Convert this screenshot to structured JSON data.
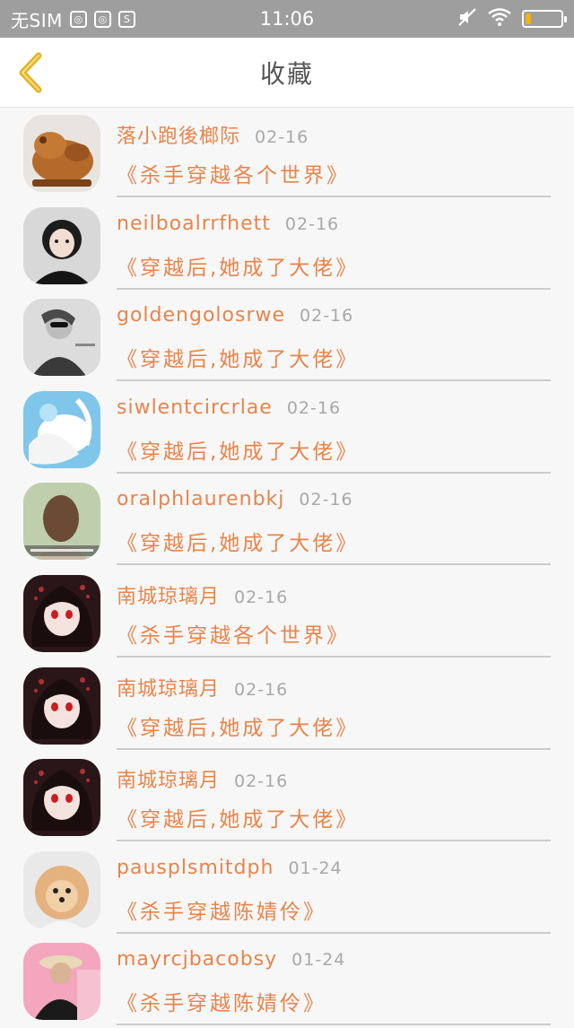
{
  "status_bar": {
    "carrier": "无SIM",
    "time": "11:06",
    "battery_level": 0.15,
    "notification_icons": [
      "qq-icon",
      "qq-icon",
      "s-app-icon"
    ],
    "notification_glyphs": [
      "◎",
      "◎",
      "S"
    ]
  },
  "header": {
    "title": "收藏"
  },
  "favorites": [
    {
      "user": "落小跑後榔际",
      "date": "02-16",
      "book": "《杀手穿越各个世界》",
      "avatar": "avatar-wood-carving"
    },
    {
      "user": "neilboalrrfhett",
      "date": "02-16",
      "book": "《穿越后,她成了大佬》",
      "avatar": "avatar-girl-dark"
    },
    {
      "user": "goldengolosrwe",
      "date": "02-16",
      "book": "《穿越后,她成了大佬》",
      "avatar": "avatar-girl-sunglasses"
    },
    {
      "user": "siwlentcircrlae",
      "date": "02-16",
      "book": "《穿越后,她成了大佬》",
      "avatar": "avatar-anime-white"
    },
    {
      "user": "oralphlaurenbkj",
      "date": "02-16",
      "book": "《穿越后,她成了大佬》",
      "avatar": "avatar-girl-back"
    },
    {
      "user": "南城琼璃月",
      "date": "02-16",
      "book": "《杀手穿越各个世界》",
      "avatar": "avatar-anime-red-eyes"
    },
    {
      "user": "南城琼璃月",
      "date": "02-16",
      "book": "《穿越后,她成了大佬》",
      "avatar": "avatar-anime-red-eyes"
    },
    {
      "user": "南城琼璃月",
      "date": "02-16",
      "book": "《穿越后,她成了大佬》",
      "avatar": "avatar-anime-red-eyes"
    },
    {
      "user": "pausplsmitdph",
      "date": "01-24",
      "book": "《杀手穿越陈婧伶》",
      "avatar": "avatar-pomeranian"
    },
    {
      "user": "mayrcjbacobsy",
      "date": "01-24",
      "book": "《杀手穿越陈婧伶》",
      "avatar": "avatar-person-hat"
    }
  ],
  "colors": {
    "accent": "#e8844a",
    "date": "#a8a8a8",
    "status_bar": "#9e9e9e",
    "back_arrow": "#e0b020"
  }
}
